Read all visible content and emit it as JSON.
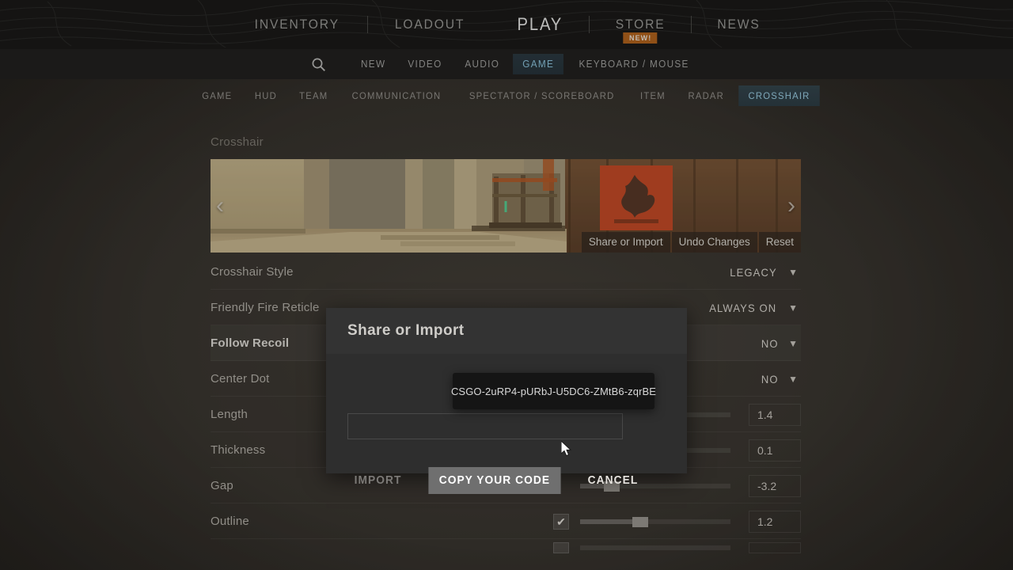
{
  "topnav": {
    "items": [
      {
        "label": "INVENTORY",
        "active": false
      },
      {
        "label": "LOADOUT",
        "active": false
      },
      {
        "label": "PLAY",
        "active": true
      },
      {
        "label": "STORE",
        "active": false,
        "badge": "NEW!"
      },
      {
        "label": "NEWS",
        "active": false
      }
    ],
    "store_badge": "NEW!",
    "store_label": "STORE"
  },
  "settings_bar": {
    "search_icon": "search-icon",
    "items": [
      {
        "label": "NEW",
        "active": false
      },
      {
        "label": "VIDEO",
        "active": false
      },
      {
        "label": "AUDIO",
        "active": false
      },
      {
        "label": "GAME",
        "active": true
      },
      {
        "label": "KEYBOARD / MOUSE",
        "active": false
      }
    ]
  },
  "tabs": [
    {
      "label": "GAME",
      "active": false
    },
    {
      "label": "HUD",
      "active": false
    },
    {
      "label": "TEAM",
      "active": false
    },
    {
      "label": "COMMUNICATION",
      "active": false
    },
    {
      "label": "SPECTATOR / SCOREBOARD",
      "active": false
    },
    {
      "label": "ITEM",
      "active": false
    },
    {
      "label": "RADAR",
      "active": false
    },
    {
      "label": "CROSSHAIR",
      "active": true
    }
  ],
  "section": {
    "title": "Crosshair"
  },
  "preview": {
    "prev_arrow": "‹",
    "next_arrow": "›",
    "buttons": [
      {
        "label": "Share or Import"
      },
      {
        "label": "Undo Changes"
      },
      {
        "label": "Reset"
      }
    ]
  },
  "rows": [
    {
      "label": "Crosshair Style",
      "type": "dropdown",
      "value": "LEGACY",
      "highlight": false
    },
    {
      "label": "Friendly Fire Reticle",
      "type": "dropdown",
      "value": "ALWAYS ON",
      "highlight": false
    },
    {
      "label": "Follow Recoil",
      "type": "dropdown",
      "value": "NO",
      "highlight": true
    },
    {
      "label": "Center Dot",
      "type": "dropdown",
      "value": "NO",
      "highlight": false
    },
    {
      "label": "Length",
      "type": "slider",
      "value": "1.4",
      "fill_pct": 33,
      "knob_pct": 33,
      "checkbox": null,
      "highlight": false
    },
    {
      "label": "Thickness",
      "type": "slider",
      "value": "0.1",
      "fill_pct": 12,
      "knob_pct": 12,
      "checkbox": null,
      "highlight": false
    },
    {
      "label": "Gap",
      "type": "slider",
      "value": "-3.2",
      "fill_pct": 21,
      "knob_pct": 21,
      "checkbox": null,
      "highlight": false
    },
    {
      "label": "Outline",
      "type": "slider",
      "value": "1.2",
      "fill_pct": 40,
      "knob_pct": 40,
      "checkbox": "✔",
      "highlight": false
    }
  ],
  "modal": {
    "title": "Share or Import",
    "input_value": "",
    "input_placeholder": "",
    "buttons": [
      {
        "label": "IMPORT",
        "state": "disabled"
      },
      {
        "label": "COPY YOUR CODE",
        "state": "hover"
      },
      {
        "label": "CANCEL",
        "state": "normal"
      }
    ]
  },
  "tooltip": {
    "text": "CSGO-2uRP4-pURbJ-U5DC6-ZMtB6-zqrBE"
  },
  "colors": {
    "accent_blue": "#9ed2e8",
    "badge_orange": "#b5651d",
    "background": "#39352f",
    "modal_bg": "#2e2e2e",
    "tooltip_bg": "#151515"
  }
}
